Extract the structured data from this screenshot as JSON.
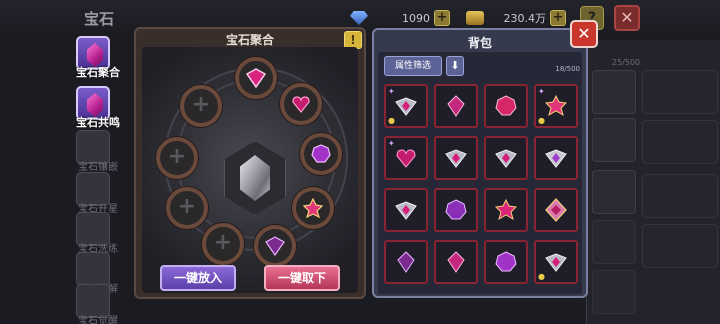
{
  "topbar": {
    "title": "宝石",
    "resources": [
      {
        "name": "diamond",
        "icon": "diamond-icon",
        "value": "1090",
        "color": "#4a7bd0"
      },
      {
        "name": "gold",
        "icon": "chest-icon",
        "value": "230.4万",
        "color": "#c9a23a"
      }
    ]
  },
  "sidemenu": [
    {
      "label": "宝石聚合",
      "icon": "gem-fusion-icon",
      "active": true
    },
    {
      "label": "宝石共鸣",
      "icon": "gem-resonance-icon",
      "active": true
    },
    {
      "label": "宝石镶嵌",
      "icon": "gem-inlay-icon",
      "active": false
    },
    {
      "label": "宝石升星",
      "icon": "star-icon",
      "active": false
    },
    {
      "label": "宝石洗练",
      "icon": "refine-icon",
      "active": false
    },
    {
      "label": "宝石分解",
      "icon": "decompose-icon",
      "active": false
    },
    {
      "label": "宝石觉醒",
      "icon": "awaken-icon",
      "active": false
    }
  ],
  "fusion": {
    "title": "宝石聚合",
    "help_icon": "exclamation-icon",
    "put_label": "一键放入",
    "take_label": "一键取下",
    "center_icon": "crystal-icon"
  },
  "bag": {
    "title": "背包",
    "filter_label": "属性筛选",
    "sort_icon": "arrow-down-icon",
    "capacity": "18/500",
    "close_icon": "close-icon"
  },
  "back": {
    "capacity": "25/500"
  }
}
